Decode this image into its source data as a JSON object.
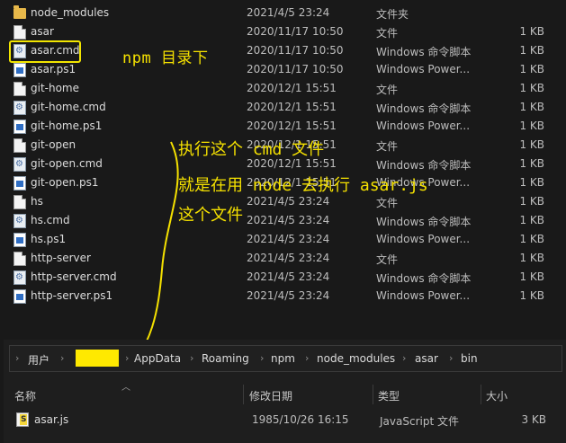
{
  "top_files": [
    {
      "name": "node_modules",
      "date": "2021/4/5 23:24",
      "type": "文件夹",
      "size": "",
      "icon": "folder-icon"
    },
    {
      "name": "asar",
      "date": "2020/11/17 10:50",
      "type": "文件",
      "size": "1 KB",
      "icon": "file-icon"
    },
    {
      "name": "asar.cmd",
      "date": "2020/11/17 10:50",
      "type": "Windows 命令脚本",
      "size": "1 KB",
      "icon": "cmd-icon"
    },
    {
      "name": "asar.ps1",
      "date": "2020/11/17 10:50",
      "type": "Windows Power...",
      "size": "1 KB",
      "icon": "powershell-icon"
    },
    {
      "name": "git-home",
      "date": "2020/12/1 15:51",
      "type": "文件",
      "size": "1 KB",
      "icon": "file-icon"
    },
    {
      "name": "git-home.cmd",
      "date": "2020/12/1 15:51",
      "type": "Windows 命令脚本",
      "size": "1 KB",
      "icon": "cmd-icon"
    },
    {
      "name": "git-home.ps1",
      "date": "2020/12/1 15:51",
      "type": "Windows Power...",
      "size": "1 KB",
      "icon": "powershell-icon"
    },
    {
      "name": "git-open",
      "date": "2020/12/1 15:51",
      "type": "文件",
      "size": "1 KB",
      "icon": "file-icon"
    },
    {
      "name": "git-open.cmd",
      "date": "2020/12/1 15:51",
      "type": "Windows 命令脚本",
      "size": "1 KB",
      "icon": "cmd-icon"
    },
    {
      "name": "git-open.ps1",
      "date": "2020/12/1 15:51",
      "type": "Windows Power...",
      "size": "1 KB",
      "icon": "powershell-icon"
    },
    {
      "name": "hs",
      "date": "2021/4/5 23:24",
      "type": "文件",
      "size": "1 KB",
      "icon": "file-icon"
    },
    {
      "name": "hs.cmd",
      "date": "2021/4/5 23:24",
      "type": "Windows 命令脚本",
      "size": "1 KB",
      "icon": "cmd-icon"
    },
    {
      "name": "hs.ps1",
      "date": "2021/4/5 23:24",
      "type": "Windows Power...",
      "size": "1 KB",
      "icon": "powershell-icon"
    },
    {
      "name": "http-server",
      "date": "2021/4/5 23:24",
      "type": "文件",
      "size": "1 KB",
      "icon": "file-icon"
    },
    {
      "name": "http-server.cmd",
      "date": "2021/4/5 23:24",
      "type": "Windows 命令脚本",
      "size": "1 KB",
      "icon": "cmd-icon"
    },
    {
      "name": "http-server.ps1",
      "date": "2021/4/5 23:24",
      "type": "Windows Power...",
      "size": "1 KB",
      "icon": "powershell-icon"
    }
  ],
  "annotations": {
    "npm_dir": "npm 目录下",
    "line1": "执行这个 cmd 文件",
    "line2": "就是在用 node 去执行 asar.js",
    "line3": "这个文件",
    "color": "#f5e100"
  },
  "breadcrumb": {
    "items": [
      "用户",
      "AppData",
      "Roaming",
      "npm",
      "node_modules",
      "asar",
      "bin"
    ]
  },
  "bottom_columns": {
    "name": "名称",
    "modified": "修改日期",
    "type": "类型",
    "size": "大小"
  },
  "bottom_file": {
    "name": "asar.js",
    "date": "1985/10/26 16:15",
    "type": "JavaScript 文件",
    "size": "3 KB",
    "icon": "javascript-file-icon"
  }
}
